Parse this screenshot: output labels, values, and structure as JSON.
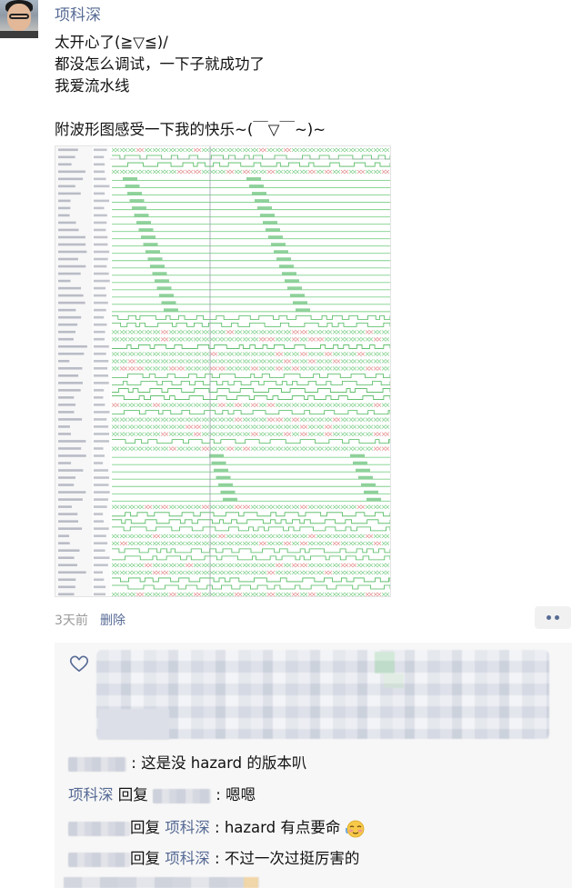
{
  "post": {
    "author": "项科深",
    "lines": [
      "太开心了(≧▽≦)/",
      "都没怎么调试，一下子就成功了",
      "我爱流水线",
      "",
      "附波形图感受一下我的快乐~(￣▽￣~)~"
    ],
    "time": "3天前",
    "delete_label": "删除"
  },
  "comments": [
    {
      "text": "这是没 hazard 的版本叭"
    },
    {
      "author": "项科深",
      "reply_word": "回复",
      "text": "嗯嗯"
    },
    {
      "reply_word": "回复",
      "target": "项科深",
      "text": "hazard 有点要命"
    },
    {
      "reply_word": "回复",
      "target": "项科深",
      "text": "不过一次过挺厉害的"
    }
  ],
  "colors": {
    "link": "#576b95",
    "text": "#111111",
    "muted": "#9a9a9a",
    "comment_bg": "#f7f7f7"
  },
  "icons": {
    "like": "heart-outline-icon",
    "more": "more-dots-icon",
    "emoji": "embarrassed-face-emoji"
  }
}
